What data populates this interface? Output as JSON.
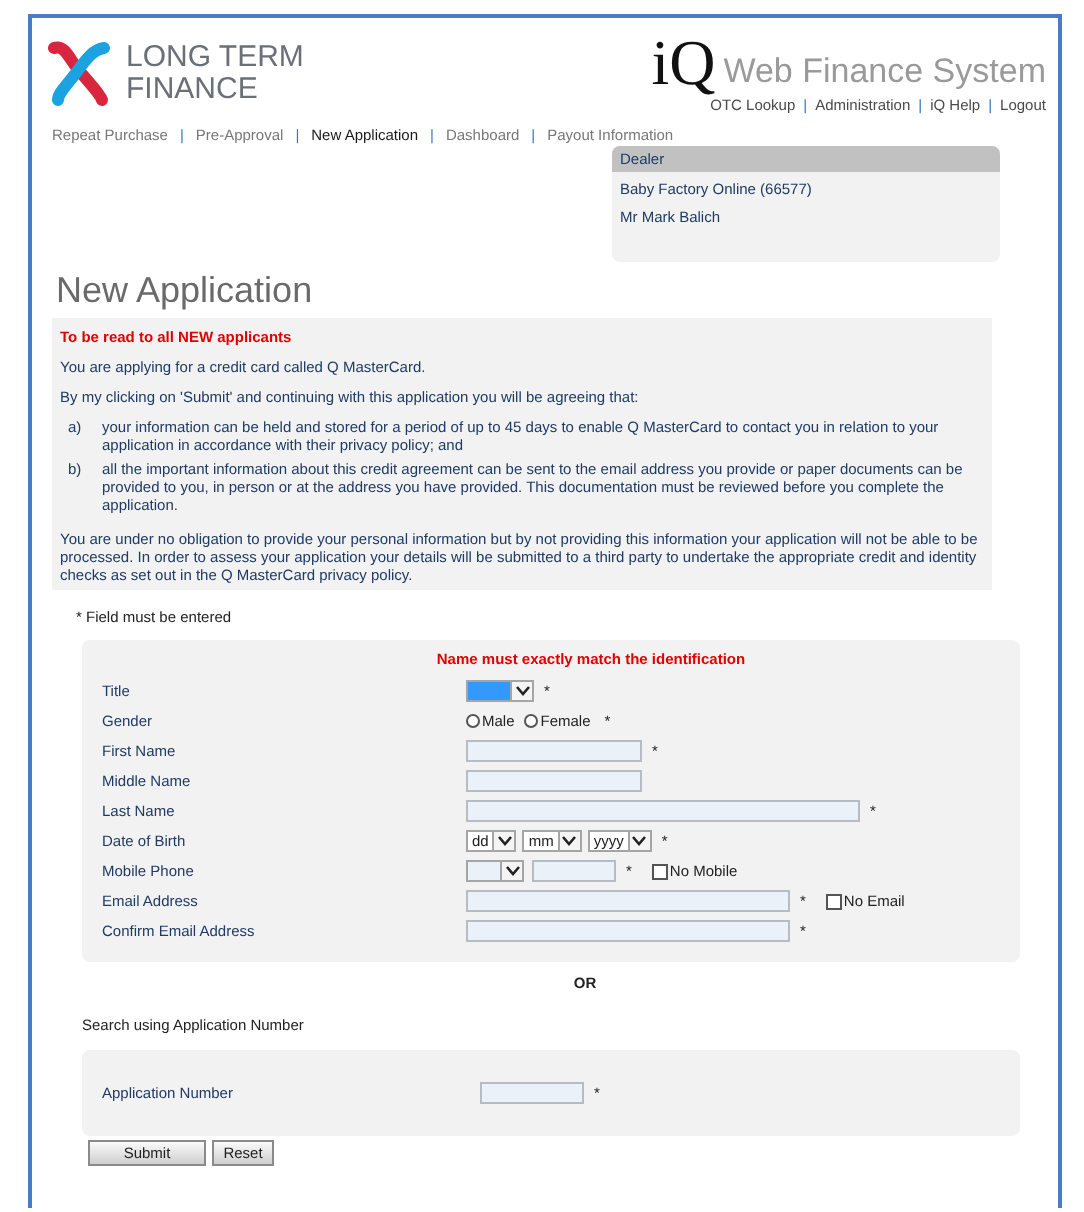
{
  "logo": {
    "lines": [
      "LONG TERM",
      "FINANCE"
    ]
  },
  "brand": {
    "mark": "iQ",
    "name": "Web Finance System"
  },
  "top_links": [
    "OTC Lookup",
    "Administration",
    "iQ Help",
    "Logout"
  ],
  "link_separator": "|",
  "nav": [
    {
      "label": "Repeat Purchase",
      "selected": false
    },
    {
      "label": "Pre-Approval",
      "selected": false
    },
    {
      "label": "New Application",
      "selected": true
    },
    {
      "label": "Dashboard",
      "selected": false
    },
    {
      "label": "Payout Information",
      "selected": false
    }
  ],
  "dealer": {
    "heading": "Dealer",
    "lines": [
      "Baby Factory Online (66577)",
      "Mr Mark Balich"
    ]
  },
  "page_title": "New Application",
  "notice": {
    "heading": "To be read to all NEW applicants",
    "intro": [
      "You are applying for a credit card called Q MasterCard.",
      "By my clicking on 'Submit' and continuing with this application you will be agreeing that:"
    ],
    "clauses": [
      {
        "marker": "a)",
        "text": "your information can be held and stored for a period of up to 45 days to enable Q MasterCard to contact you in relation to your application in accordance with their privacy policy; and"
      },
      {
        "marker": "b)",
        "text": "all the important information about this credit agreement can be sent to the email address you provide or paper documents can be provided to you, in person or at the address you have provided. This documentation must be reviewed before you complete the application."
      }
    ],
    "closing": "You are under no obligation to provide your personal information but by not providing this information your application will not be able to be processed. In order to assess your application your details will be submitted to a third party to undertake the appropriate credit and identity checks as set out in the Q MasterCard privacy policy."
  },
  "required_note": "* Field must be entered",
  "required_mark": "*",
  "form": {
    "heading": "Name must exactly match the identification",
    "fields": [
      {
        "label": "Title",
        "kind": "select",
        "focused": true,
        "required": true
      },
      {
        "label": "Gender",
        "kind": "radio",
        "required": true,
        "options": [
          {
            "label": "Male",
            "selected": false
          },
          {
            "label": "Female",
            "selected": false
          }
        ]
      },
      {
        "label": "First Name",
        "kind": "text",
        "required": true
      },
      {
        "label": "Middle Name",
        "kind": "text",
        "required": false
      },
      {
        "label": "Last Name",
        "kind": "longtext",
        "required": true
      },
      {
        "label": "Date of Birth",
        "kind": "date",
        "required": true,
        "parts": [
          "dd",
          "mm",
          "yyyy"
        ]
      },
      {
        "label": "Mobile Phone",
        "kind": "phone",
        "required": true,
        "checkbox": {
          "label": "No Mobile",
          "checked": false
        }
      },
      {
        "label": "Email Address",
        "kind": "email",
        "required": true,
        "checkbox": {
          "label": "No Email",
          "checked": false
        }
      },
      {
        "label": "Confirm Email Address",
        "kind": "email",
        "required": true
      }
    ]
  },
  "or_text": "OR",
  "search_label": "Search using Application Number",
  "application_form": {
    "fields": [
      {
        "label": "Application Number",
        "kind": "number",
        "required": true
      }
    ]
  },
  "buttons": [
    "Submit",
    "Reset"
  ]
}
